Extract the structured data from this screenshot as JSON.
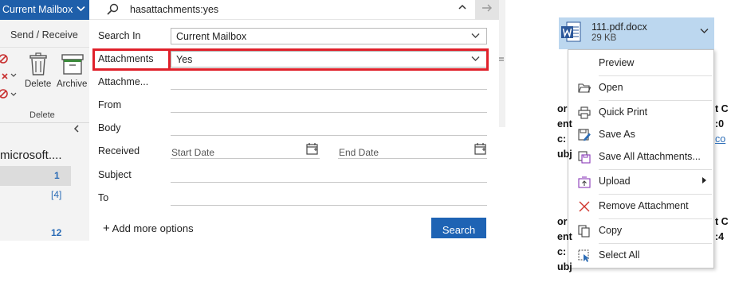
{
  "ribbon": {
    "mailbox_label": "Current Mailbox",
    "send_receive": "Send / Receive",
    "delete_label": "Delete",
    "archive_label": "Archive",
    "group_label": "Delete",
    "folder_name": "microsoft....",
    "counts": [
      "1",
      "[4]",
      "12"
    ]
  },
  "search": {
    "query": "hasattachments:yes",
    "fields": {
      "search_in": "Search In",
      "search_in_value": "Current Mailbox",
      "attachments": "Attachments",
      "attachments_value": "Yes",
      "attachme": "Attachme...",
      "from": "From",
      "body": "Body",
      "received": "Received",
      "start_date_placeholder": "Start Date",
      "end_date_placeholder": "End Date",
      "subject": "Subject",
      "to": "To"
    },
    "add_more_options": "Add more options",
    "search_button": "Search"
  },
  "attachment": {
    "file_name": "111.pdf.docx",
    "file_size": "29 KB",
    "icon": "word-icon"
  },
  "context_menu": {
    "items": [
      {
        "label": "Preview",
        "icon": "preview-icon"
      },
      {
        "label": "Open",
        "icon": "folder-open-icon"
      },
      {
        "label": "Quick Print",
        "icon": "printer-icon"
      },
      {
        "label": "Save As",
        "icon": "save-as-icon"
      },
      {
        "label": "Save All Attachments...",
        "icon": "save-all-icon"
      },
      {
        "label": "Upload",
        "icon": "upload-icon"
      },
      {
        "label": "Remove Attachment",
        "icon": "remove-icon"
      },
      {
        "label": "Copy",
        "icon": "copy-icon"
      },
      {
        "label": "Select All",
        "icon": "select-all-icon"
      }
    ]
  },
  "background_fragments": {
    "rows1": [
      "or",
      "ent",
      "c:",
      "ubj"
    ],
    "rows1_right": [
      "t C",
      ":0",
      "co"
    ],
    "rows2": [
      "or",
      "ent",
      "c:",
      "ubj"
    ],
    "rows2_right": [
      "t C",
      ":4"
    ]
  },
  "colors": {
    "accent_blue": "#1f5faa",
    "highlight_red": "#e0202a",
    "chip_bg": "#bcd7ef",
    "word_blue": "#2b579a"
  }
}
